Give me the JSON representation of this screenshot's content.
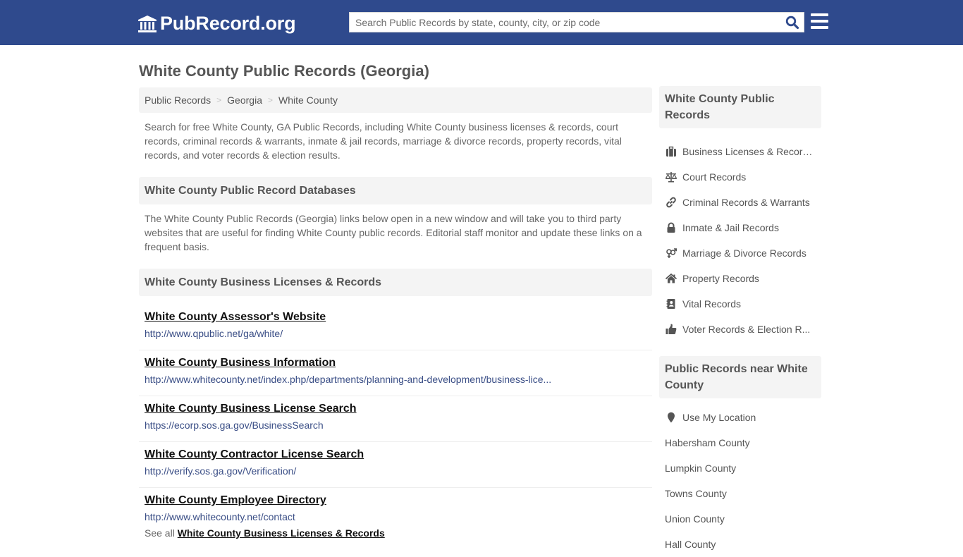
{
  "header": {
    "logo_text": "PubRecord.org",
    "logo_icon": "courthouse-icon",
    "search_placeholder": "Search Public Records by state, county, city, or zip code",
    "search_value": "",
    "search_icon": "search-icon",
    "menu_icon": "hamburger-menu-icon",
    "brand_color": "#2f4a8d"
  },
  "page": {
    "title": "White County Public Records (Georgia)"
  },
  "breadcrumb": [
    {
      "label": "Public Records"
    },
    {
      "label": "Georgia"
    },
    {
      "label": "White County"
    }
  ],
  "breadcrumb_separator": ">",
  "intro": "Search for free White County, GA Public Records, including White County business licenses & records, court records, criminal records & warrants, inmate & jail records, marriage & divorce records, property records, vital records, and voter records & election results.",
  "databases": {
    "heading": "White County Public Record Databases",
    "description": "The White County Public Records (Georgia) links below open in a new window and will take you to third party websites that are useful for finding White County public records. Editorial staff monitor and update these links on a frequent basis."
  },
  "business": {
    "heading": "White County Business Licenses & Records",
    "links": [
      {
        "title": "White County Assessor's Website",
        "url": "http://www.qpublic.net/ga/white/"
      },
      {
        "title": "White County Business Information",
        "url": "http://www.whitecounty.net/index.php/departments/planning-and-development/business-lice..."
      },
      {
        "title": "White County Business License Search",
        "url": "https://ecorp.sos.ga.gov/BusinessSearch"
      },
      {
        "title": "White County Contractor License Search",
        "url": "http://verify.sos.ga.gov/Verification/"
      },
      {
        "title": "White County Employee Directory",
        "url": "http://www.whitecounty.net/contact"
      }
    ],
    "see_all_prefix": "See all",
    "see_all_link": "White County Business Licenses & Records"
  },
  "sidebar": {
    "records_heading": "White County Public Records",
    "records": [
      {
        "label": "Business Licenses & Records",
        "icon": "briefcase-icon"
      },
      {
        "label": "Court Records",
        "icon": "balance-scale-icon"
      },
      {
        "label": "Criminal Records & Warrants",
        "icon": "link-chain-icon"
      },
      {
        "label": "Inmate & Jail Records",
        "icon": "lock-icon"
      },
      {
        "label": "Marriage & Divorce Records",
        "icon": "gender-symbol-icon"
      },
      {
        "label": "Property Records",
        "icon": "home-icon"
      },
      {
        "label": "Vital Records",
        "icon": "address-book-icon"
      },
      {
        "label": "Voter Records & Election R...",
        "icon": "thumbs-up-icon"
      }
    ],
    "near_heading": "Public Records near White County",
    "use_location": {
      "label": "Use My Location",
      "icon": "map-marker-icon"
    },
    "nearby": [
      {
        "label": "Habersham County"
      },
      {
        "label": "Lumpkin County"
      },
      {
        "label": "Towns County"
      },
      {
        "label": "Union County"
      },
      {
        "label": "Hall County"
      }
    ]
  }
}
